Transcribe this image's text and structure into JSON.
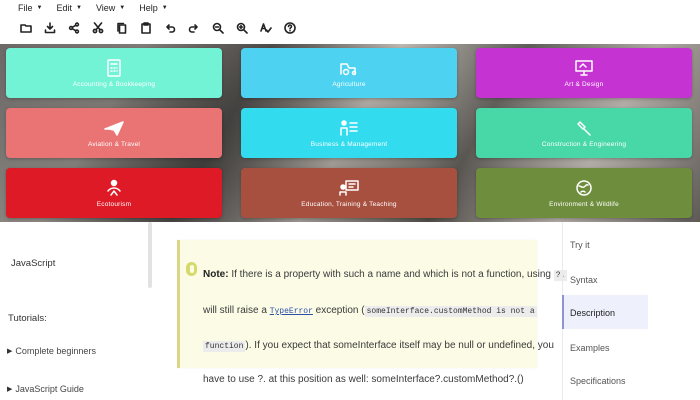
{
  "menubar": {
    "items": [
      "File",
      "Edit",
      "View",
      "Help"
    ]
  },
  "toolbar": {
    "icons": [
      "folder-icon",
      "download-icon",
      "share-icon",
      "cut-icon",
      "copy-icon",
      "paste-icon",
      "undo-icon",
      "redo-icon",
      "zoom-out-icon",
      "zoom-in-icon",
      "spellcheck-icon",
      "help-icon"
    ]
  },
  "categories": [
    {
      "label": "Accounting & Bookkeeping",
      "color": "#73f3d6",
      "icon": "calculator-icon"
    },
    {
      "label": "Agriculture",
      "color": "#4dd3f1",
      "icon": "tractor-icon"
    },
    {
      "label": "Art & Design",
      "color": "#c534d2",
      "icon": "monitor-icon"
    },
    {
      "label": "Aviation & Travel",
      "color": "#ea7474",
      "icon": "airplane-icon"
    },
    {
      "label": "Business & Management",
      "color": "#33dbee",
      "icon": "business-icon"
    },
    {
      "label": "Construction & Engineering",
      "color": "#48d7a7",
      "icon": "tools-icon"
    },
    {
      "label": "Ecotourism",
      "color": "#dd1a26",
      "icon": "hiker-icon"
    },
    {
      "label": "Education, Training & Teaching",
      "color": "#a85040",
      "icon": "teacher-icon"
    },
    {
      "label": "Environment & Wildlife",
      "color": "#6e8e3d",
      "icon": "globe-icon"
    }
  ],
  "left_nav": {
    "title": "JavaScript",
    "heading": "Tutorials:",
    "links": [
      "Complete beginners",
      "JavaScript Guide"
    ]
  },
  "note": {
    "label": "Note:",
    "line1_text": " If there is a property with such a name and which is not a function, using ",
    "line1_code": "?.",
    "line2_a": "will still raise a ",
    "line2_link": "TypeError",
    "line2_b": " exception (",
    "line2_code": "someInterface.customMethod is not a",
    "line3_code": "function",
    "line3_text": "). If you expect that someInterface itself may be null or undefined, you",
    "line4_text": "have to use ?. at this position as well: someInterface?.customMethod?.()"
  },
  "right_nav": {
    "items": [
      "Try it",
      "Syntax",
      "Description",
      "Examples",
      "Specifications"
    ],
    "active": "Description"
  }
}
